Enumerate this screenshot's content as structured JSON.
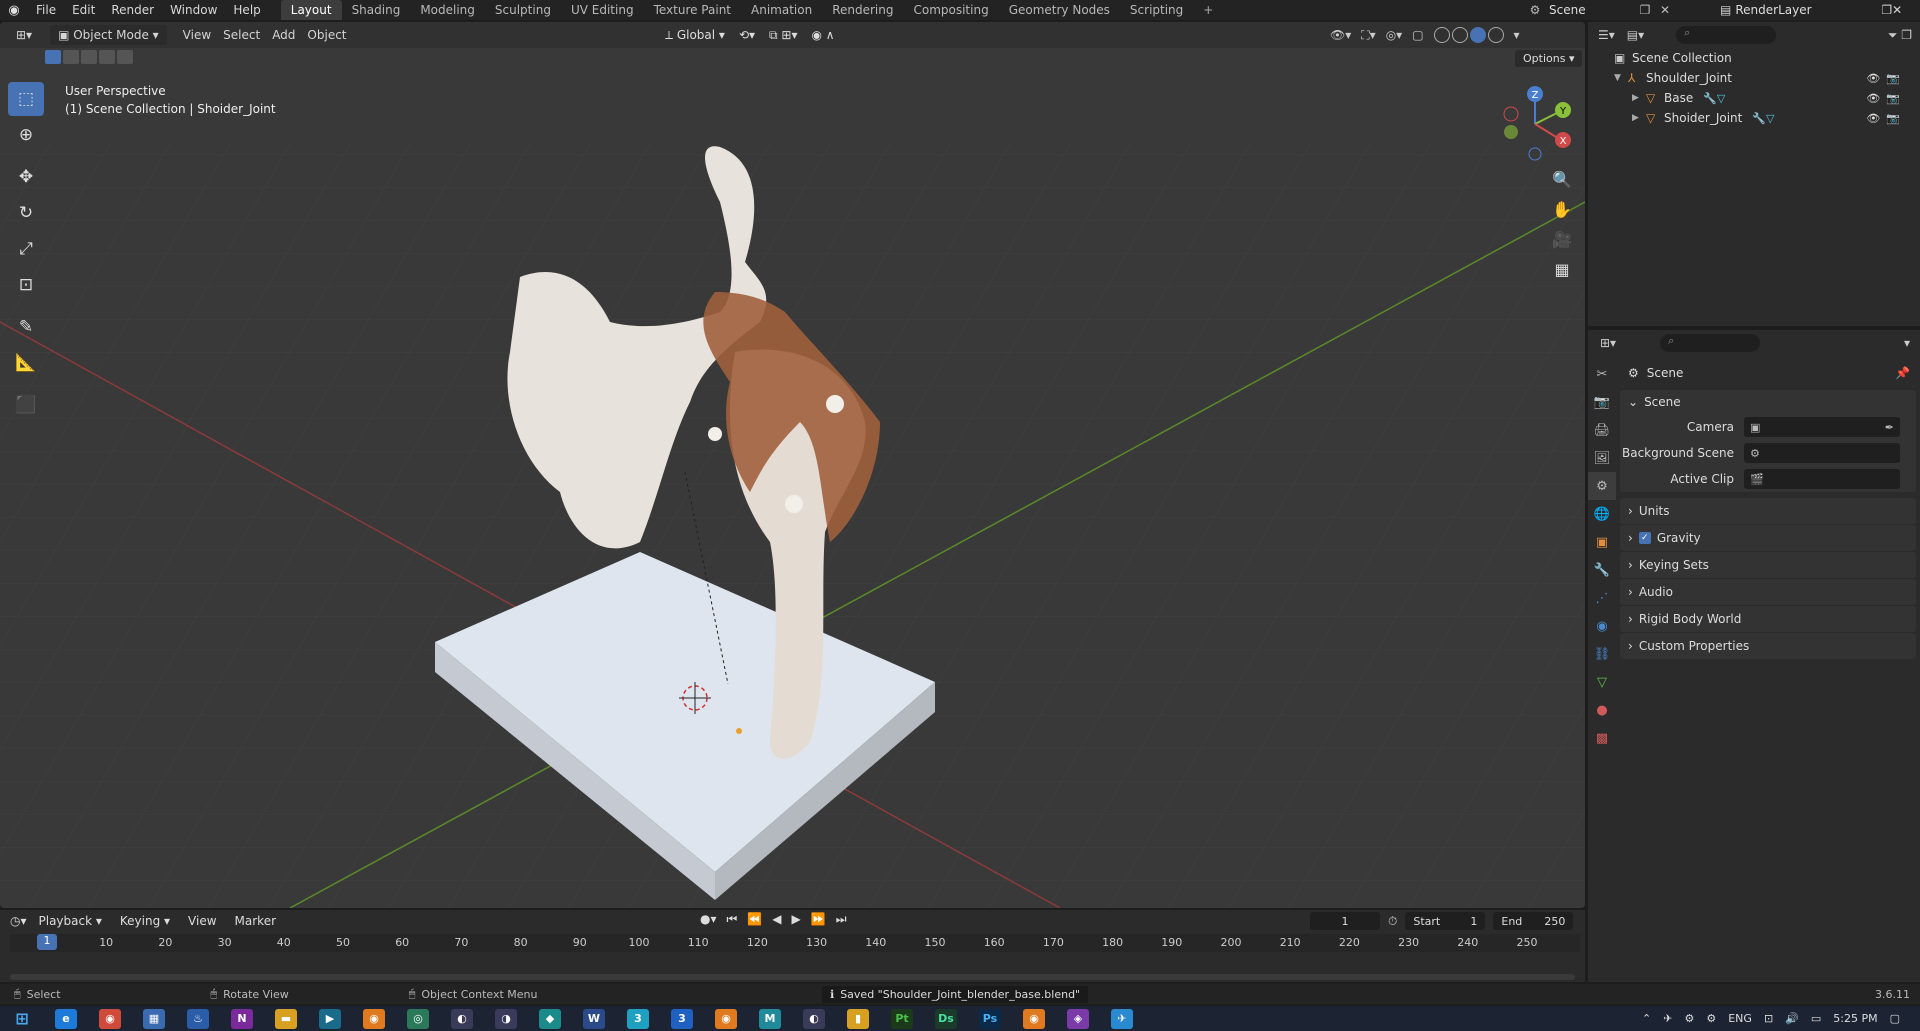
{
  "app": {
    "menu": [
      "File",
      "Edit",
      "Render",
      "Window",
      "Help"
    ],
    "workspace_tabs": [
      "Layout",
      "Shading",
      "Modeling",
      "Sculpting",
      "UV Editing",
      "Texture Paint",
      "Animation",
      "Rendering",
      "Compositing",
      "Geometry Nodes",
      "Scripting"
    ],
    "active_tab": "Layout",
    "scene_name": "Scene",
    "render_layer": "RenderLayer"
  },
  "viewport": {
    "mode": "Object Mode",
    "menus": [
      "View",
      "Select",
      "Add",
      "Object"
    ],
    "transform": "Global",
    "options_label": "Options",
    "info_line1": "User Perspective",
    "info_line2": "(1) Scene Collection | Shoider_Joint",
    "gizmo_axes": [
      "X",
      "Y",
      "Z"
    ]
  },
  "outliner": {
    "root": "Scene Collection",
    "items": [
      {
        "name": "Shoulder_Joint",
        "level": 1
      },
      {
        "name": "Base",
        "level": 2
      },
      {
        "name": "Shoider_Joint",
        "level": 2
      }
    ]
  },
  "properties": {
    "title": "Scene",
    "panel_title": "Scene",
    "fields": [
      {
        "label": "Camera",
        "value": ""
      },
      {
        "label": "Background Scene",
        "value": ""
      },
      {
        "label": "Active Clip",
        "value": ""
      }
    ],
    "subpanels": [
      "Units",
      "Gravity",
      "Keying Sets",
      "Audio",
      "Rigid Body World",
      "Custom Properties"
    ],
    "gravity_checked": true
  },
  "timeline": {
    "menus": [
      "Playback",
      "Keying",
      "View",
      "Marker"
    ],
    "current_frame": "1",
    "start_label": "Start",
    "start": "1",
    "end_label": "End",
    "end": "250",
    "ticks": [
      "1",
      "10",
      "20",
      "30",
      "40",
      "50",
      "60",
      "70",
      "80",
      "90",
      "100",
      "110",
      "120",
      "130",
      "140",
      "150",
      "160",
      "170",
      "180",
      "190",
      "200",
      "210",
      "220",
      "230",
      "240",
      "250"
    ]
  },
  "status": {
    "select": "Select",
    "rotate": "Rotate View",
    "context": "Object Context Menu",
    "message": "Saved \"Shoulder_Joint_blender_base.blend\"",
    "version": "3.6.11"
  },
  "taskbar": {
    "lang": "ENG",
    "time": "5:25 PM"
  }
}
